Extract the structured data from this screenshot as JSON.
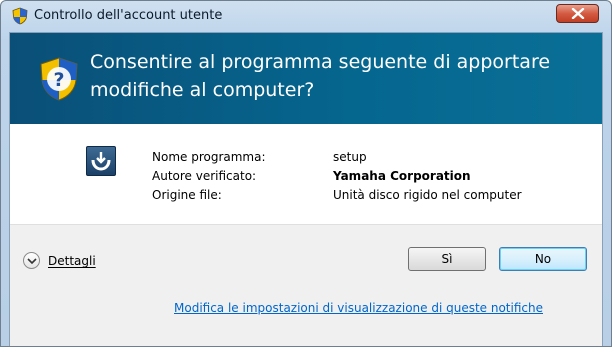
{
  "window": {
    "title": "Controllo dell'account utente",
    "title_icon": "uac-shield-icon",
    "close_icon": "close-icon"
  },
  "banner": {
    "icon": "uac-question-shield-icon",
    "line1": "Consentire al programma seguente di apportare",
    "line2": "modifiche al computer?"
  },
  "program": {
    "icon": "setup-app-icon",
    "rows": [
      {
        "label": "Nome programma:",
        "value": "setup"
      },
      {
        "label": "Autore verificato:",
        "value": "Yamaha Corporation"
      },
      {
        "label": "Origine file:",
        "value": "Unità disco rigido nel computer"
      }
    ]
  },
  "footer": {
    "details_label": "Dettagli",
    "yes_label": "Sì",
    "no_label": "No",
    "settings_link": "Modifica le impostazioni di visualizzazione di queste notifiche"
  },
  "colors": {
    "banner": "#06527b",
    "link": "#0066cc",
    "footer_bg": "#f0f0f0"
  }
}
